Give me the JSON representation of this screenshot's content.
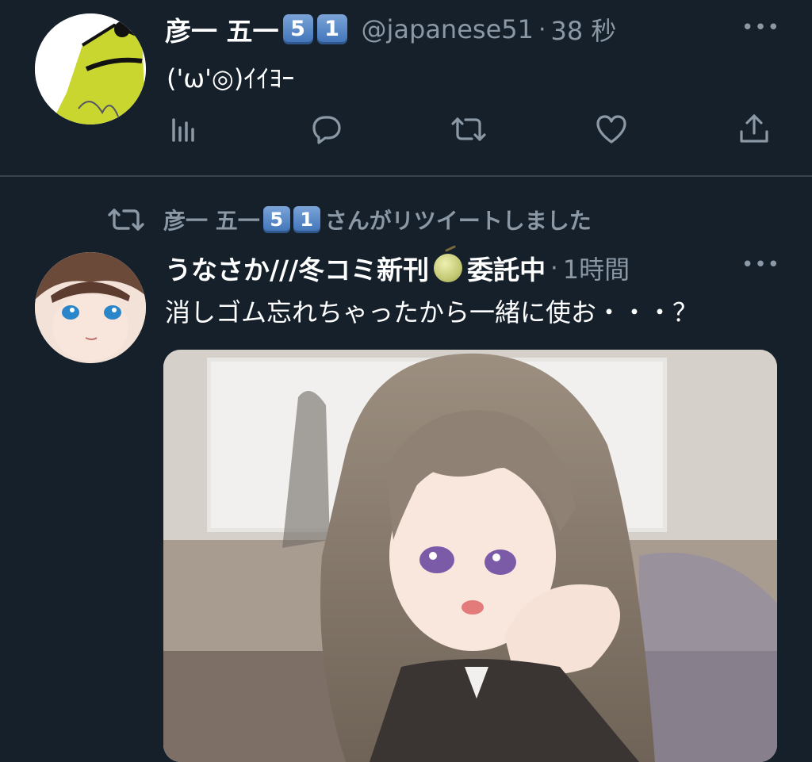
{
  "tweet1": {
    "name": "彦一 五一",
    "emoji1": "5",
    "emoji2": "1",
    "handle": "@japanese51",
    "separator": "·",
    "time": "38 秒",
    "text": "('ω'◎)ｲｲﾖｰ",
    "more": "•••"
  },
  "tweet2": {
    "retweet": {
      "name": "彦一 五一",
      "emoji1": "5",
      "emoji2": "1",
      "suffix": "さんがリツイートしました"
    },
    "name_part1": "うなさか///冬コミ新刊",
    "name_part2": "委託中",
    "separator": "·",
    "time": "1時間",
    "text": "消しゴム忘れちゃったから一緒に使お・・・？",
    "more": "•••"
  },
  "icons": [
    "analytics-icon",
    "reply-icon",
    "retweet-icon",
    "like-icon",
    "share-icon",
    "melon-emoji"
  ],
  "colors": {
    "background": "#15202b",
    "divider": "#38444d",
    "secondary_text": "#8b98a5",
    "primary_text": "#ffffff",
    "keycap": "#3e72b8"
  }
}
